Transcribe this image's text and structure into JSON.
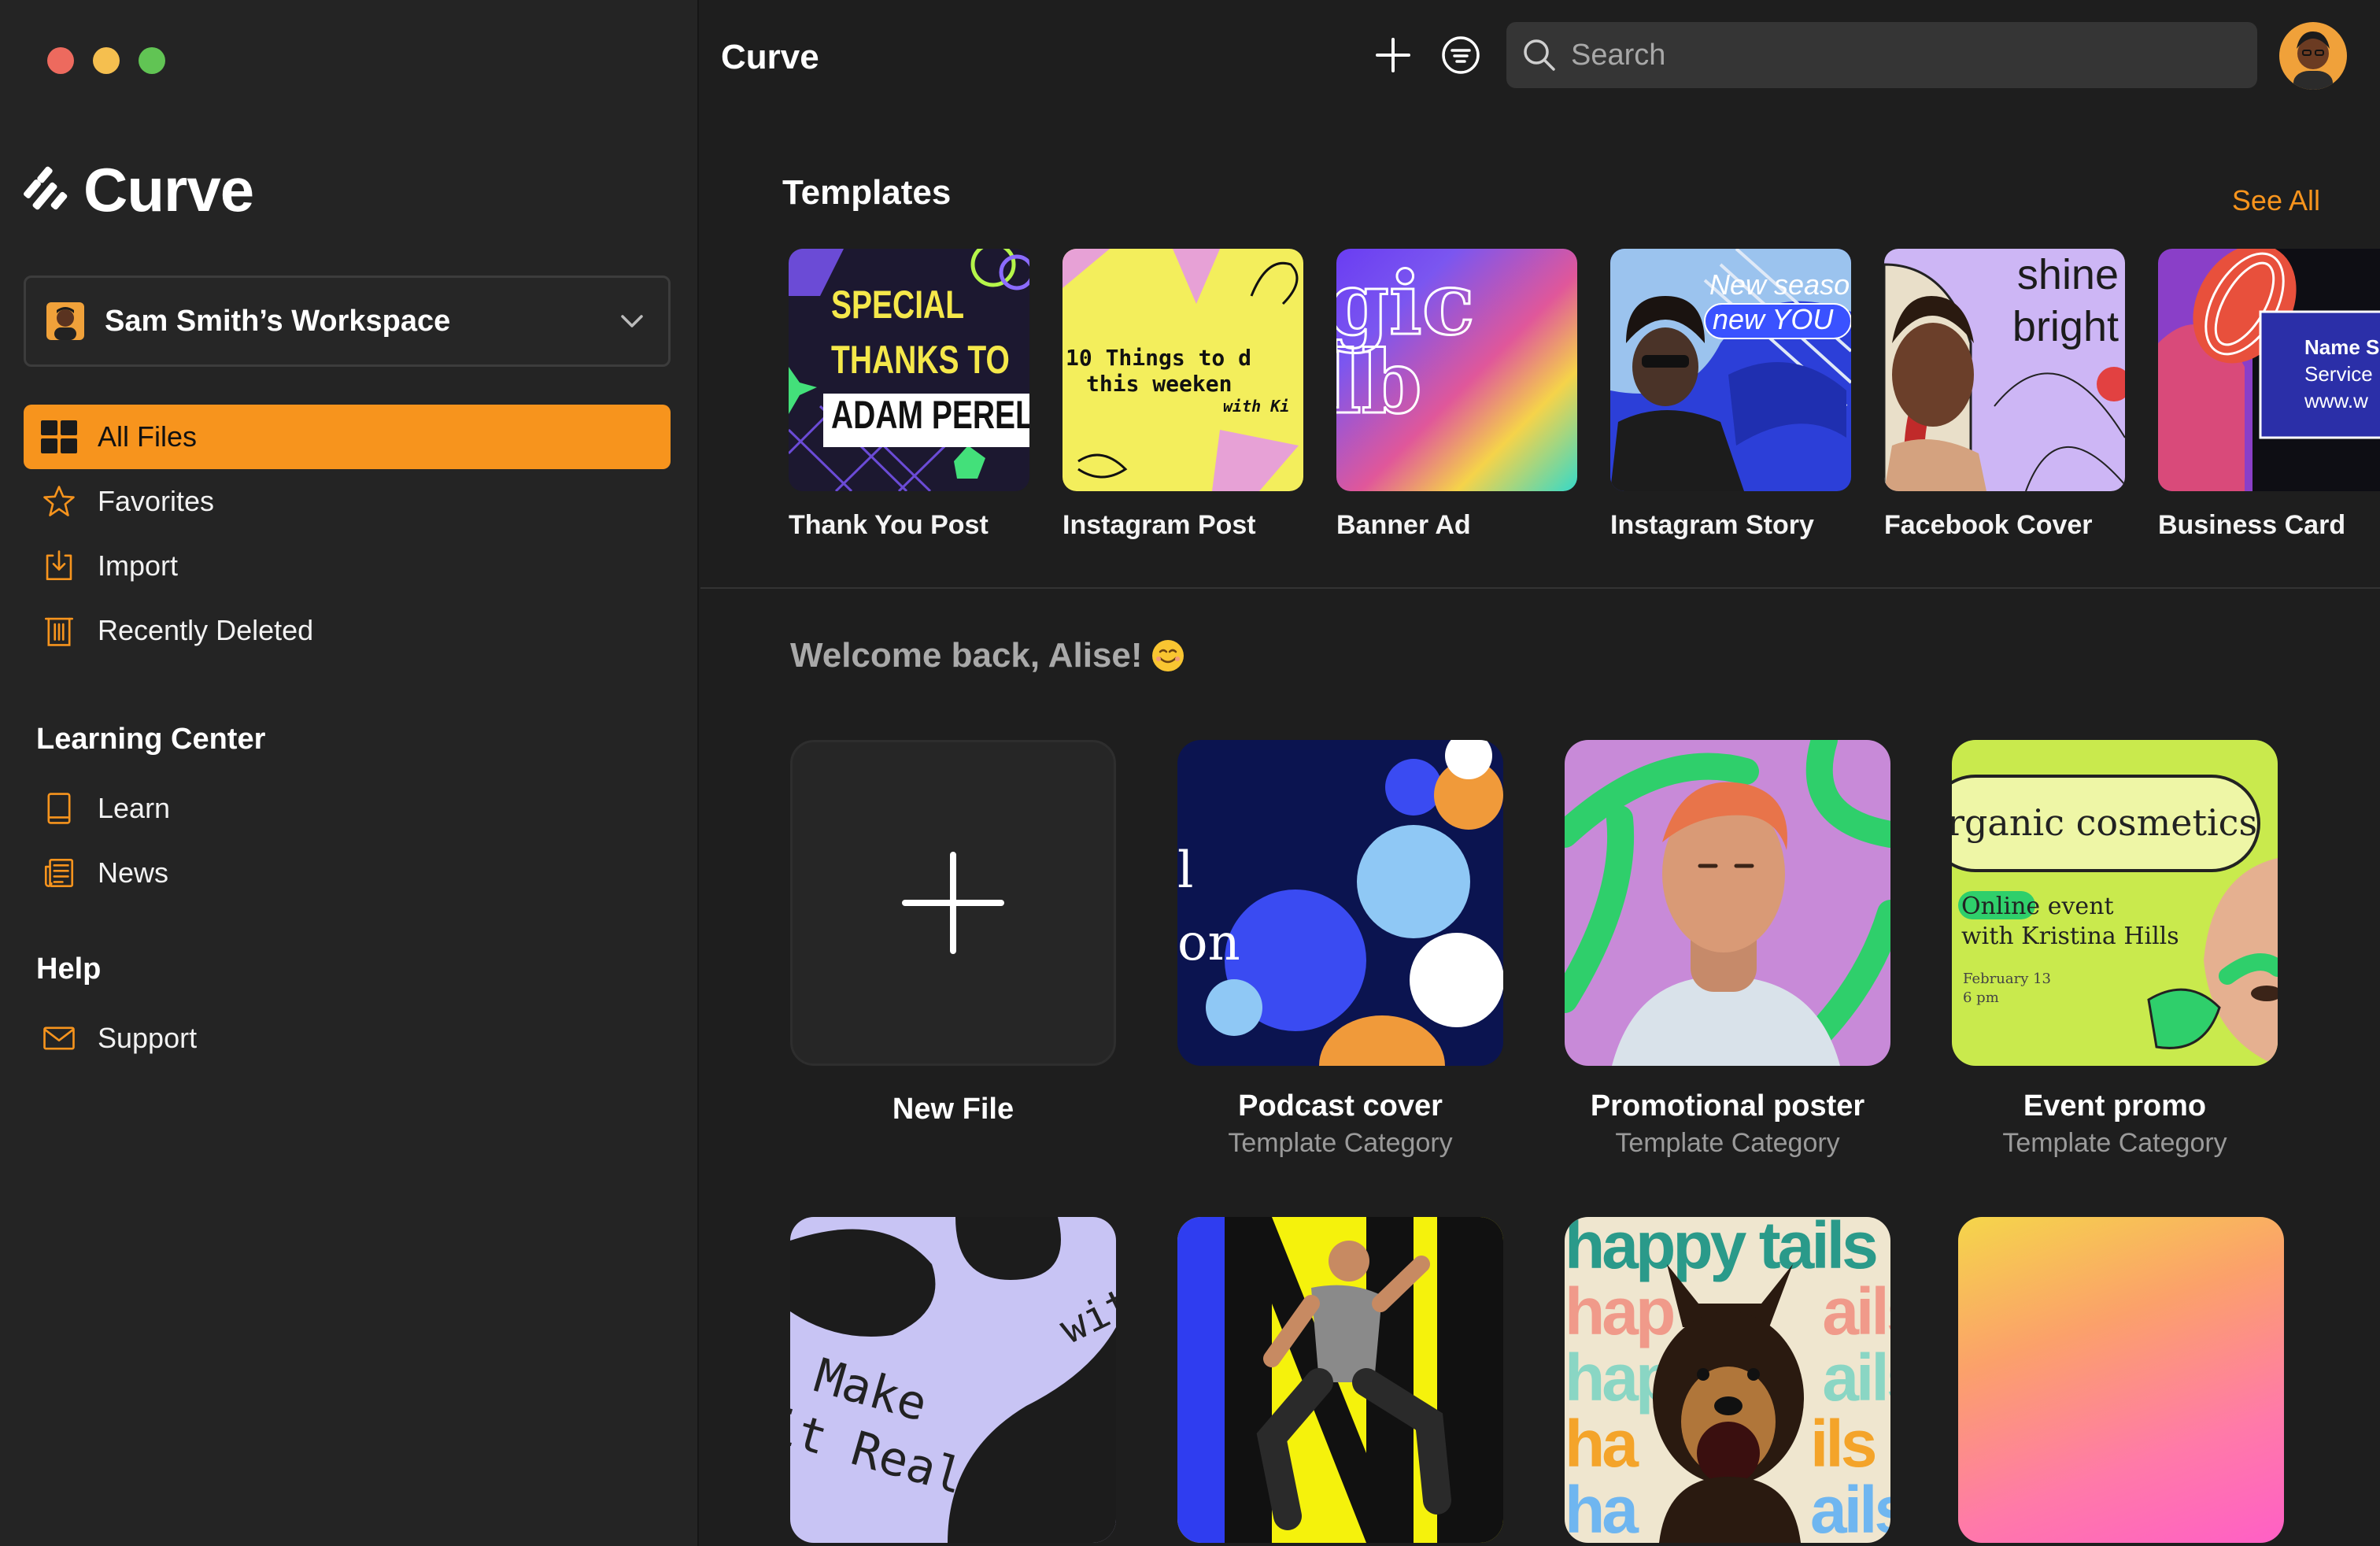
{
  "window": {
    "app_title": "Curve"
  },
  "sidebar": {
    "logo_text": "Curve",
    "workspace": {
      "name": "Sam Smith’s Workspace"
    },
    "nav": [
      {
        "label": "All Files",
        "icon": "grid-icon"
      },
      {
        "label": "Favorites",
        "icon": "star-icon"
      },
      {
        "label": "Import",
        "icon": "import-icon"
      },
      {
        "label": "Recently Deleted",
        "icon": "trash-icon"
      }
    ],
    "learning_center": {
      "title": "Learning Center",
      "items": [
        {
          "label": "Learn",
          "icon": "book-icon"
        },
        {
          "label": "News",
          "icon": "newspaper-icon"
        }
      ]
    },
    "help": {
      "title": "Help",
      "items": [
        {
          "label": "Support",
          "icon": "mail-icon"
        }
      ]
    }
  },
  "topbar": {
    "search_placeholder": "Search"
  },
  "templates": {
    "heading": "Templates",
    "see_all": "See All",
    "items": [
      {
        "label": "Thank You Post",
        "text": [
          "SPECIAL",
          "THANKS TO",
          "ADAM PEREL"
        ]
      },
      {
        "label": "Instagram Post",
        "text": [
          "10 Things to d",
          "this weeken",
          "with Ki"
        ]
      },
      {
        "label": "Banner Ad",
        "text": [
          "gic",
          "lb"
        ]
      },
      {
        "label": "Instagram Story",
        "text": [
          "New seaso",
          "new YOU"
        ]
      },
      {
        "label": "Facebook Cover",
        "text": [
          "shine",
          "bright"
        ]
      },
      {
        "label": "Business Card",
        "text": [
          "Name S",
          "Service",
          "www.w"
        ]
      }
    ]
  },
  "welcome": {
    "text": "Welcome back, Alise!",
    "emoji": "😊"
  },
  "files": {
    "new_file_label": "New File",
    "items": [
      {
        "title": "Podcast cover",
        "subtitle": "Template Category",
        "text": [
          "l",
          "on"
        ]
      },
      {
        "title": "Promotional poster",
        "subtitle": "Template Category"
      },
      {
        "title": "Event promo",
        "subtitle": "Template Category",
        "text": [
          "rganic cosmetics",
          "Online",
          "event",
          "with Kristina Hills",
          "February 13",
          "6 pm"
        ]
      }
    ],
    "row2": [
      {
        "text": [
          "Make",
          "it Real",
          "wit"
        ]
      },
      {
        "text": []
      },
      {
        "text": [
          "happy tails",
          "hap",
          "ails",
          "hap",
          "ails",
          "ha",
          "ils",
          "ha",
          "ails"
        ]
      },
      {
        "text": []
      }
    ]
  },
  "colors": {
    "accent": "#f7941d",
    "sidebar_bg": "#242424",
    "content_bg": "#1e1e1e"
  }
}
